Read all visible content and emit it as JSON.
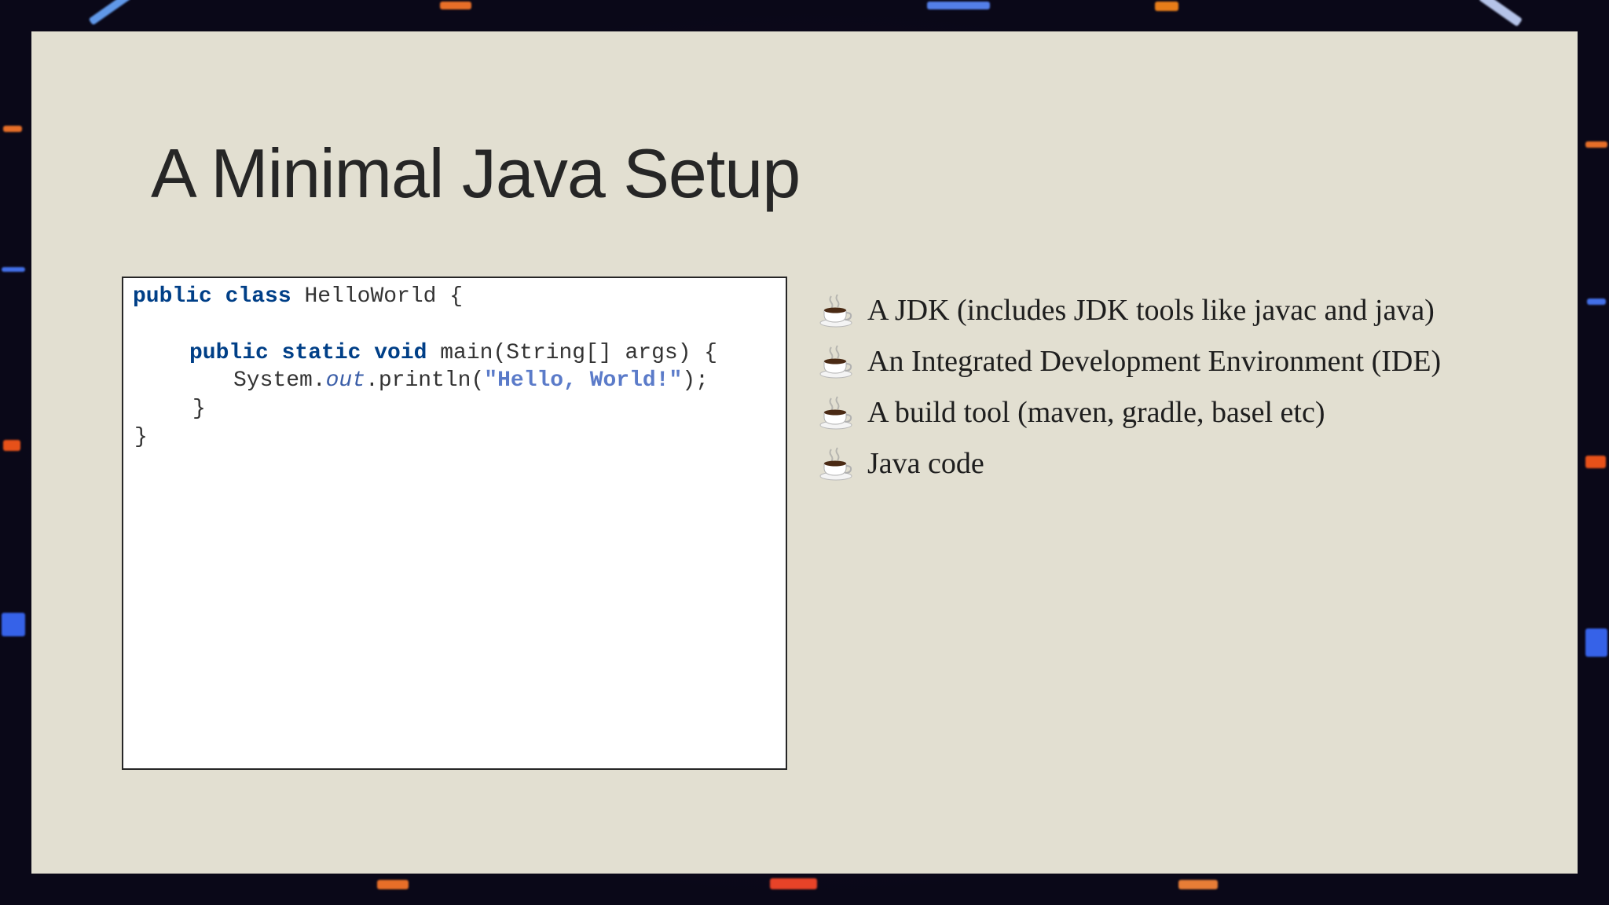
{
  "slide": {
    "title": "A Minimal Java Setup",
    "code": {
      "line1": {
        "kw": "public class",
        "rest": " HelloWorld {"
      },
      "line3": {
        "kw": "public static void",
        "rest": " main(String[] args) {"
      },
      "line4": {
        "pre": "System.",
        "italic": "out",
        "mid": ".println(",
        "str": "\"Hello, World!\"",
        "post": ");"
      },
      "line5": "}",
      "line6": "}"
    },
    "bullets": [
      {
        "icon": "coffee-cup-icon",
        "text": "A JDK (includes JDK tools like javac and java)"
      },
      {
        "icon": "coffee-cup-icon",
        "text": "An Integrated Development Environment (IDE)"
      },
      {
        "icon": "coffee-cup-icon",
        "text": "A build tool (maven, gradle, basel etc)"
      },
      {
        "icon": "coffee-cup-icon",
        "text": "Java code"
      }
    ]
  },
  "colors": {
    "slide_background": "#e2dfd1",
    "title_text": "#262626",
    "keyword": "#003f87",
    "string": "#5b7bc9",
    "accent_streak_blue": "#3d7bff",
    "accent_streak_orange": "#ff6a1a"
  }
}
